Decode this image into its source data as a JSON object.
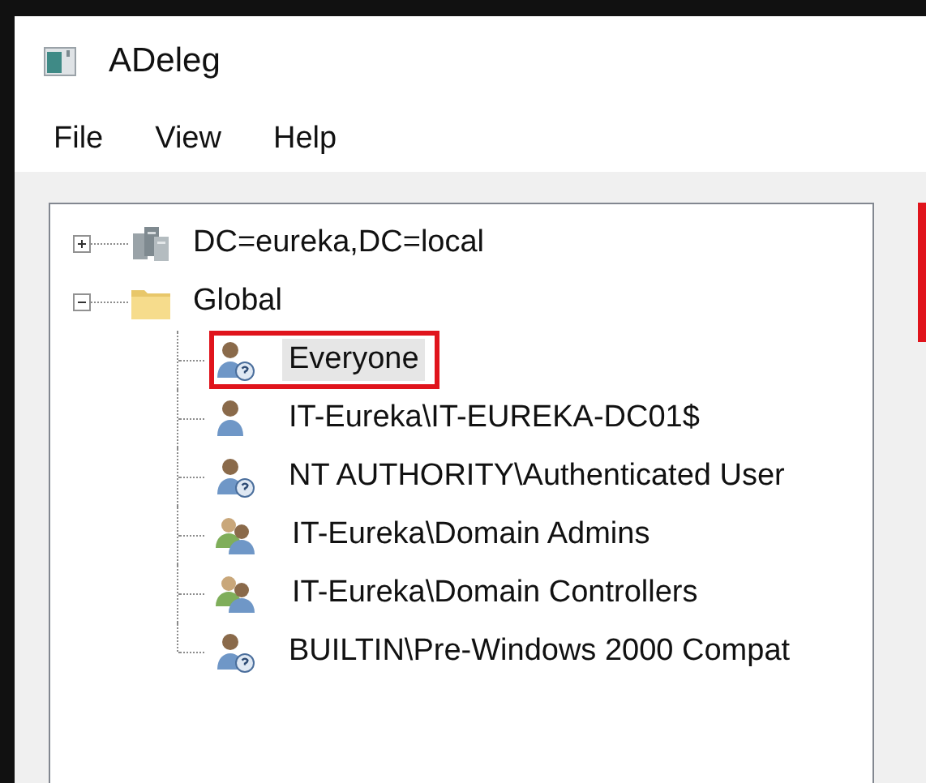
{
  "window": {
    "title": "ADeleg"
  },
  "menu": [
    "File",
    "View",
    "Help"
  ],
  "tree": [
    {
      "label": "DC=eureka,DC=local",
      "kind": "domain",
      "expanded": false
    },
    {
      "label": "Global",
      "kind": "folder",
      "expanded": true,
      "children": [
        {
          "label": "Everyone",
          "kind": "unknown-user",
          "selected": true,
          "annotated": true
        },
        {
          "label": "IT-Eureka\\IT-EUREKA-DC01$",
          "kind": "user",
          "selected": false,
          "annotated": false
        },
        {
          "label": "NT AUTHORITY\\Authenticated User",
          "kind": "unknown-user",
          "selected": false,
          "annotated": false
        },
        {
          "label": "IT-Eureka\\Domain Admins",
          "kind": "group",
          "selected": false,
          "annotated": false
        },
        {
          "label": "IT-Eureka\\Domain Controllers",
          "kind": "group",
          "selected": false,
          "annotated": false
        },
        {
          "label": "BUILTIN\\Pre-Windows 2000 Compat",
          "kind": "unknown-user",
          "selected": false,
          "annotated": false
        }
      ]
    }
  ]
}
